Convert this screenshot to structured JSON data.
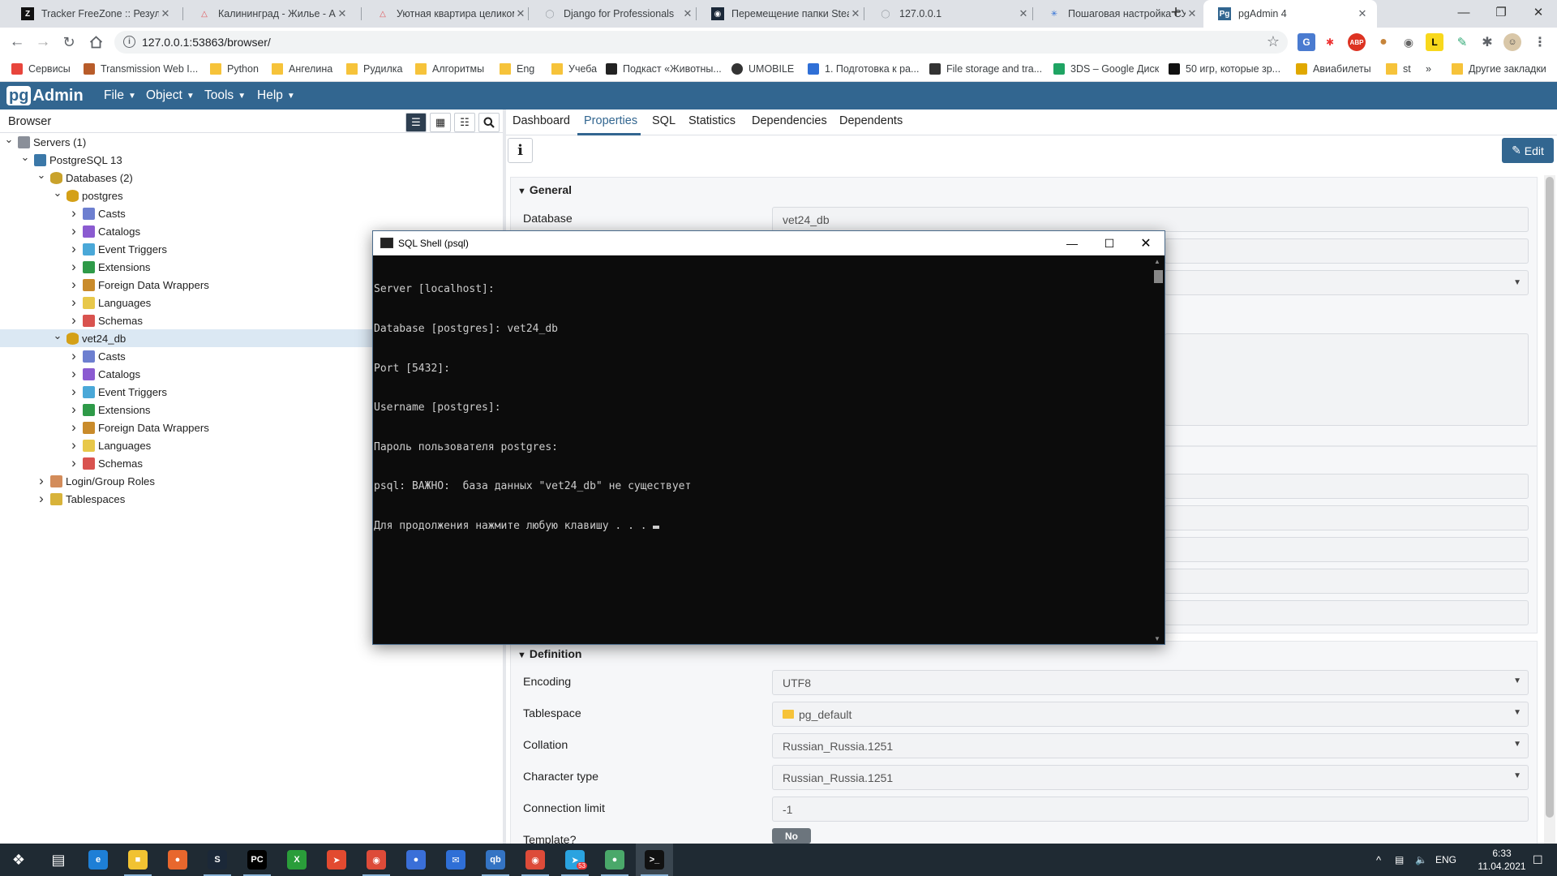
{
  "window": {
    "tabs": [
      {
        "title": "Tracker FreeZone :: Результ",
        "icon": "freezone-icon"
      },
      {
        "title": "Калининград - Жилье - Airb",
        "icon": "airbnb-icon"
      },
      {
        "title": "Уютная квартира целиком",
        "icon": "airbnb-icon"
      },
      {
        "title": "Django for Professionals",
        "icon": "loading-icon"
      },
      {
        "title": "Перемещение папки Steam",
        "icon": "steam-icon"
      },
      {
        "title": "127.0.0.1",
        "icon": "loading-icon"
      },
      {
        "title": "Пошаговая настройка СУБ",
        "icon": "gear-icon"
      },
      {
        "title": "pgAdmin 4",
        "icon": "pgadmin-icon"
      }
    ],
    "new_tab": "+",
    "minimize": "—",
    "restore": "❐",
    "close": "✕"
  },
  "toolbar": {
    "url": "127.0.0.1:53863/browser/",
    "info": "i",
    "star": "☆"
  },
  "bookmarks": [
    {
      "label": "Сервисы",
      "icon": "apps-icon"
    },
    {
      "label": "Transmission Web I...",
      "icon": "transmission-icon"
    },
    {
      "label": "Python",
      "icon": "folder-icon"
    },
    {
      "label": "Ангелина",
      "icon": "folder-icon"
    },
    {
      "label": "Рудилка",
      "icon": "folder-icon"
    },
    {
      "label": "Алгоритмы",
      "icon": "folder-icon"
    },
    {
      "label": "Eng",
      "icon": "folder-icon"
    },
    {
      "label": "Учеба",
      "icon": "folder-icon"
    },
    {
      "label": "Подкаст «Животны...",
      "icon": "podcast-icon"
    },
    {
      "label": "UMOBILE",
      "icon": "umobile-icon"
    },
    {
      "label": "1. Подготовка к ра...",
      "icon": "stack-icon"
    },
    {
      "label": "File storage and tra...",
      "icon": "storage-icon"
    },
    {
      "label": "3DS – Google Диск",
      "icon": "drive-icon"
    },
    {
      "label": "50 игр, которые зр...",
      "icon": "ad-icon"
    },
    {
      "label": "Авиабилеты",
      "icon": "plane-icon"
    },
    {
      "label": "st",
      "icon": "folder-icon"
    },
    {
      "label": "»",
      "icon": ""
    },
    {
      "label": "Другие закладки",
      "icon": "folder-icon"
    }
  ],
  "pgadmin": {
    "logo_pg": "pg",
    "logo_admin": "Admin",
    "menu": [
      "File",
      "Object",
      "Tools",
      "Help"
    ]
  },
  "browser": {
    "title": "Browser",
    "tree": [
      {
        "label": "Servers (1)",
        "level": 0,
        "expanded": true,
        "icon": "servers-icon"
      },
      {
        "label": "PostgreSQL 13",
        "level": 1,
        "expanded": true,
        "icon": "postgres-server-icon"
      },
      {
        "label": "Databases (2)",
        "level": 2,
        "expanded": true,
        "icon": "databases-icon"
      },
      {
        "label": "postgres",
        "level": 3,
        "expanded": true,
        "icon": "database-icon"
      },
      {
        "label": "Casts",
        "level": 4,
        "expanded": false,
        "icon": "casts-icon"
      },
      {
        "label": "Catalogs",
        "level": 4,
        "expanded": false,
        "icon": "catalogs-icon"
      },
      {
        "label": "Event Triggers",
        "level": 4,
        "expanded": false,
        "icon": "event-triggers-icon"
      },
      {
        "label": "Extensions",
        "level": 4,
        "expanded": false,
        "icon": "extensions-icon"
      },
      {
        "label": "Foreign Data Wrappers",
        "level": 4,
        "expanded": false,
        "icon": "fdw-icon"
      },
      {
        "label": "Languages",
        "level": 4,
        "expanded": false,
        "icon": "languages-icon"
      },
      {
        "label": "Schemas",
        "level": 4,
        "expanded": false,
        "icon": "schemas-icon"
      },
      {
        "label": "vet24_db",
        "level": 3,
        "expanded": true,
        "icon": "database-icon",
        "selected": true
      },
      {
        "label": "Casts",
        "level": 4,
        "expanded": false,
        "icon": "casts-icon"
      },
      {
        "label": "Catalogs",
        "level": 4,
        "expanded": false,
        "icon": "catalogs-icon"
      },
      {
        "label": "Event Triggers",
        "level": 4,
        "expanded": false,
        "icon": "event-triggers-icon"
      },
      {
        "label": "Extensions",
        "level": 4,
        "expanded": false,
        "icon": "extensions-icon"
      },
      {
        "label": "Foreign Data Wrappers",
        "level": 4,
        "expanded": false,
        "icon": "fdw-icon"
      },
      {
        "label": "Languages",
        "level": 4,
        "expanded": false,
        "icon": "languages-icon"
      },
      {
        "label": "Schemas",
        "level": 4,
        "expanded": false,
        "icon": "schemas-icon"
      },
      {
        "label": "Login/Group Roles",
        "level": 2,
        "expanded": false,
        "icon": "roles-icon"
      },
      {
        "label": "Tablespaces",
        "level": 2,
        "expanded": false,
        "icon": "tablespaces-icon"
      }
    ]
  },
  "properties": {
    "tabs": [
      "Dashboard",
      "Properties",
      "SQL",
      "Statistics",
      "Dependencies",
      "Dependents"
    ],
    "active_tab": "Properties",
    "info_label": "i",
    "edit_label": "Edit",
    "general": {
      "title": "General",
      "database_label": "Database",
      "database_value": "vet24_db"
    },
    "definition": {
      "title": "Definition",
      "rows": [
        {
          "label": "Encoding",
          "value": "UTF8",
          "dropdown": true
        },
        {
          "label": "Tablespace",
          "value": "pg_default",
          "dropdown": true,
          "folder": true
        },
        {
          "label": "Collation",
          "value": "Russian_Russia.1251",
          "dropdown": true
        },
        {
          "label": "Character type",
          "value": "Russian_Russia.1251",
          "dropdown": true
        },
        {
          "label": "Connection limit",
          "value": "-1",
          "dropdown": false
        }
      ],
      "template_label": "Template?",
      "template_value": "No"
    }
  },
  "psql": {
    "title": "SQL Shell (psql)",
    "lines": [
      "Server [localhost]:",
      "Database [postgres]: vet24_db",
      "Port [5432]:",
      "Username [postgres]:",
      "Пароль пользователя postgres:",
      "psql: ВАЖНО:  база данных \"vet24_db\" не существует",
      "Для продолжения нажмите любую клавишу . . . "
    ]
  },
  "taskbar": {
    "apps": [
      "start",
      "task-view",
      "edge",
      "explorer",
      "firefox",
      "steam",
      "pycharm",
      "xbox",
      "share",
      "chrome",
      "droplet",
      "mail",
      "qbittorrent",
      "chrome",
      "telegram",
      "pgadmin-elephant",
      "terminal"
    ],
    "telegram_badge": "53",
    "tray_up": "^",
    "language": "ENG",
    "time": "6:33",
    "date": "11.04.2021"
  },
  "colors": {
    "pg_blue": "#326690",
    "console_bg": "#0c0c0c",
    "selected_row": "#dbe8f3"
  }
}
